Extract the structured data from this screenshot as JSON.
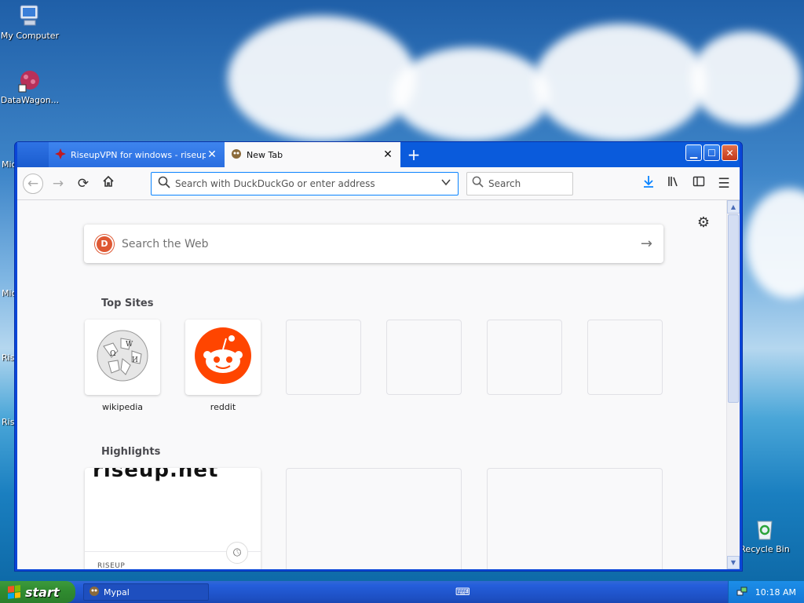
{
  "desktop": {
    "icons": [
      {
        "label": "My Computer"
      },
      {
        "label": "DataWagon..."
      },
      {
        "label": "Recycle Bin"
      }
    ],
    "edge_labels": [
      "Mic",
      "Mic",
      "Ris",
      "Ris"
    ]
  },
  "browser": {
    "tabs": [
      {
        "label": "RiseupVPN for windows - riseup.net",
        "active": false
      },
      {
        "label": "New Tab",
        "active": true
      }
    ],
    "url_placeholder": "Search with DuckDuckGo or enter address",
    "search_placeholder": "Search",
    "newtab": {
      "search_placeholder": "Search the Web",
      "top_sites_title": "Top Sites",
      "top_sites": [
        {
          "label": "wikipedia"
        },
        {
          "label": "reddit"
        }
      ],
      "highlights_title": "Highlights",
      "highlight_card": {
        "image_text": "riseup.net",
        "source": "RISEUP"
      }
    }
  },
  "taskbar": {
    "start_label": "start",
    "task_label": "Mypal",
    "clock": "10:18 AM"
  },
  "colors": {
    "xp_blue": "#0a5bdc",
    "accent": "#0a84ff",
    "reddit": "#ff4500",
    "ddg": "#de5833"
  }
}
